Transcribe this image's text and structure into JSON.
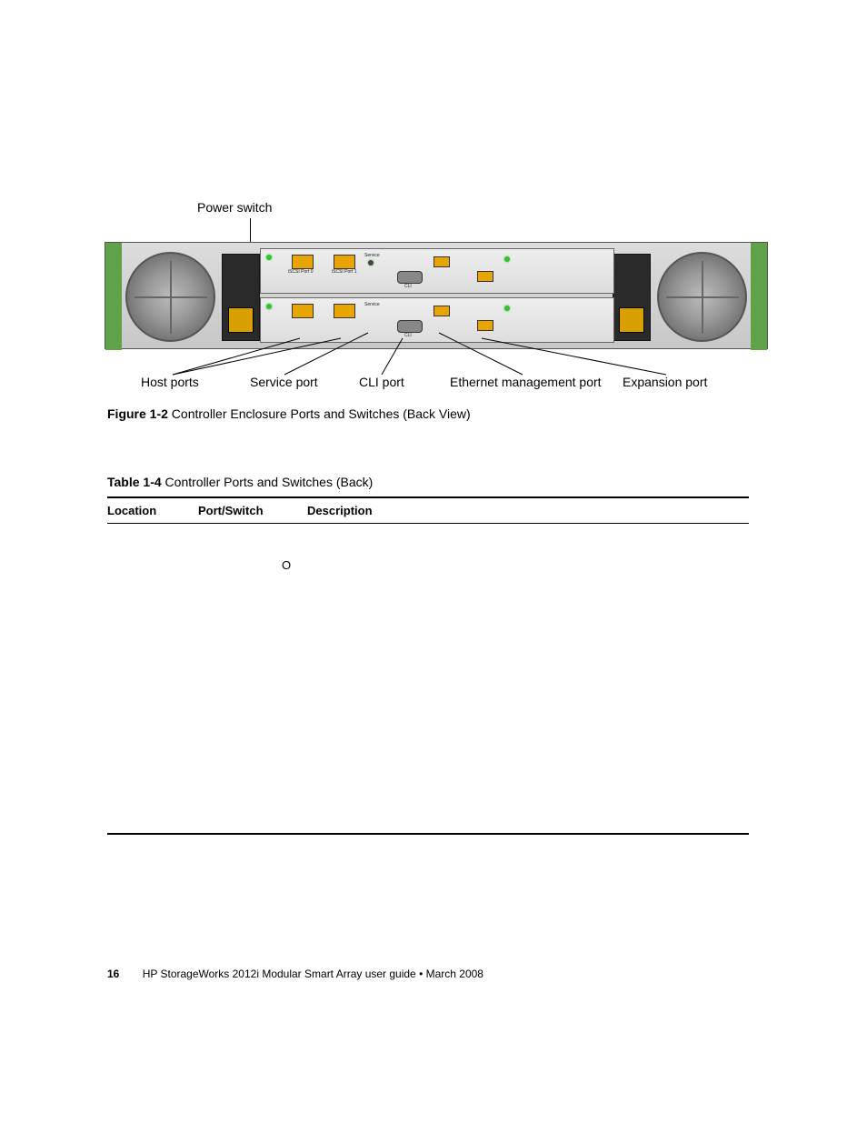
{
  "figure": {
    "labels": {
      "power_switch": "Power switch",
      "host_ports": "Host ports",
      "service_port": "Service port",
      "cli_port": "CLI port",
      "ethernet_mgmt": "Ethernet management port",
      "expansion_port": "Expansion port"
    },
    "caption_bold": "Figure 1-2",
    "caption_rest": " Controller Enclosure Ports and Switches (Back View)"
  },
  "table": {
    "title_bold": "Table 1-4",
    "title_rest": " Controller Ports and Switches (Back)",
    "headers": {
      "location": "Location",
      "port_switch": "Port/Switch",
      "description": "Description"
    },
    "stray_marker": "O"
  },
  "footer": {
    "page_number": "16",
    "doc_title": "HP StorageWorks 2012i Modular Smart Array user guide",
    "separator": "  •  ",
    "date": "March 2008"
  }
}
